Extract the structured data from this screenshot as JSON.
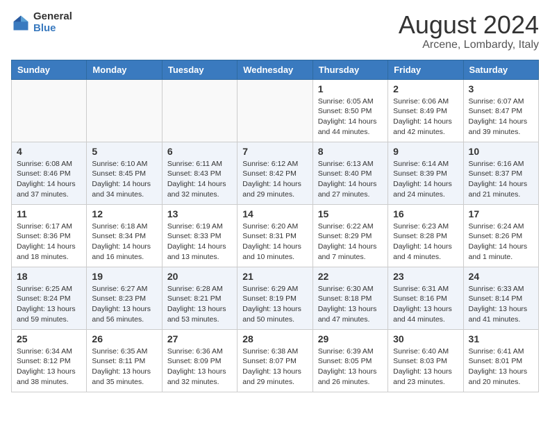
{
  "header": {
    "logo_general": "General",
    "logo_blue": "Blue",
    "main_title": "August 2024",
    "subtitle": "Arcene, Lombardy, Italy"
  },
  "weekdays": [
    "Sunday",
    "Monday",
    "Tuesday",
    "Wednesday",
    "Thursday",
    "Friday",
    "Saturday"
  ],
  "weeks": [
    [
      {
        "day": "",
        "info": ""
      },
      {
        "day": "",
        "info": ""
      },
      {
        "day": "",
        "info": ""
      },
      {
        "day": "",
        "info": ""
      },
      {
        "day": "1",
        "info": "Sunrise: 6:05 AM\nSunset: 8:50 PM\nDaylight: 14 hours\nand 44 minutes."
      },
      {
        "day": "2",
        "info": "Sunrise: 6:06 AM\nSunset: 8:49 PM\nDaylight: 14 hours\nand 42 minutes."
      },
      {
        "day": "3",
        "info": "Sunrise: 6:07 AM\nSunset: 8:47 PM\nDaylight: 14 hours\nand 39 minutes."
      }
    ],
    [
      {
        "day": "4",
        "info": "Sunrise: 6:08 AM\nSunset: 8:46 PM\nDaylight: 14 hours\nand 37 minutes."
      },
      {
        "day": "5",
        "info": "Sunrise: 6:10 AM\nSunset: 8:45 PM\nDaylight: 14 hours\nand 34 minutes."
      },
      {
        "day": "6",
        "info": "Sunrise: 6:11 AM\nSunset: 8:43 PM\nDaylight: 14 hours\nand 32 minutes."
      },
      {
        "day": "7",
        "info": "Sunrise: 6:12 AM\nSunset: 8:42 PM\nDaylight: 14 hours\nand 29 minutes."
      },
      {
        "day": "8",
        "info": "Sunrise: 6:13 AM\nSunset: 8:40 PM\nDaylight: 14 hours\nand 27 minutes."
      },
      {
        "day": "9",
        "info": "Sunrise: 6:14 AM\nSunset: 8:39 PM\nDaylight: 14 hours\nand 24 minutes."
      },
      {
        "day": "10",
        "info": "Sunrise: 6:16 AM\nSunset: 8:37 PM\nDaylight: 14 hours\nand 21 minutes."
      }
    ],
    [
      {
        "day": "11",
        "info": "Sunrise: 6:17 AM\nSunset: 8:36 PM\nDaylight: 14 hours\nand 18 minutes."
      },
      {
        "day": "12",
        "info": "Sunrise: 6:18 AM\nSunset: 8:34 PM\nDaylight: 14 hours\nand 16 minutes."
      },
      {
        "day": "13",
        "info": "Sunrise: 6:19 AM\nSunset: 8:33 PM\nDaylight: 14 hours\nand 13 minutes."
      },
      {
        "day": "14",
        "info": "Sunrise: 6:20 AM\nSunset: 8:31 PM\nDaylight: 14 hours\nand 10 minutes."
      },
      {
        "day": "15",
        "info": "Sunrise: 6:22 AM\nSunset: 8:29 PM\nDaylight: 14 hours\nand 7 minutes."
      },
      {
        "day": "16",
        "info": "Sunrise: 6:23 AM\nSunset: 8:28 PM\nDaylight: 14 hours\nand 4 minutes."
      },
      {
        "day": "17",
        "info": "Sunrise: 6:24 AM\nSunset: 8:26 PM\nDaylight: 14 hours\nand 1 minute."
      }
    ],
    [
      {
        "day": "18",
        "info": "Sunrise: 6:25 AM\nSunset: 8:24 PM\nDaylight: 13 hours\nand 59 minutes."
      },
      {
        "day": "19",
        "info": "Sunrise: 6:27 AM\nSunset: 8:23 PM\nDaylight: 13 hours\nand 56 minutes."
      },
      {
        "day": "20",
        "info": "Sunrise: 6:28 AM\nSunset: 8:21 PM\nDaylight: 13 hours\nand 53 minutes."
      },
      {
        "day": "21",
        "info": "Sunrise: 6:29 AM\nSunset: 8:19 PM\nDaylight: 13 hours\nand 50 minutes."
      },
      {
        "day": "22",
        "info": "Sunrise: 6:30 AM\nSunset: 8:18 PM\nDaylight: 13 hours\nand 47 minutes."
      },
      {
        "day": "23",
        "info": "Sunrise: 6:31 AM\nSunset: 8:16 PM\nDaylight: 13 hours\nand 44 minutes."
      },
      {
        "day": "24",
        "info": "Sunrise: 6:33 AM\nSunset: 8:14 PM\nDaylight: 13 hours\nand 41 minutes."
      }
    ],
    [
      {
        "day": "25",
        "info": "Sunrise: 6:34 AM\nSunset: 8:12 PM\nDaylight: 13 hours\nand 38 minutes."
      },
      {
        "day": "26",
        "info": "Sunrise: 6:35 AM\nSunset: 8:11 PM\nDaylight: 13 hours\nand 35 minutes."
      },
      {
        "day": "27",
        "info": "Sunrise: 6:36 AM\nSunset: 8:09 PM\nDaylight: 13 hours\nand 32 minutes."
      },
      {
        "day": "28",
        "info": "Sunrise: 6:38 AM\nSunset: 8:07 PM\nDaylight: 13 hours\nand 29 minutes."
      },
      {
        "day": "29",
        "info": "Sunrise: 6:39 AM\nSunset: 8:05 PM\nDaylight: 13 hours\nand 26 minutes."
      },
      {
        "day": "30",
        "info": "Sunrise: 6:40 AM\nSunset: 8:03 PM\nDaylight: 13 hours\nand 23 minutes."
      },
      {
        "day": "31",
        "info": "Sunrise: 6:41 AM\nSunset: 8:01 PM\nDaylight: 13 hours\nand 20 minutes."
      }
    ]
  ]
}
